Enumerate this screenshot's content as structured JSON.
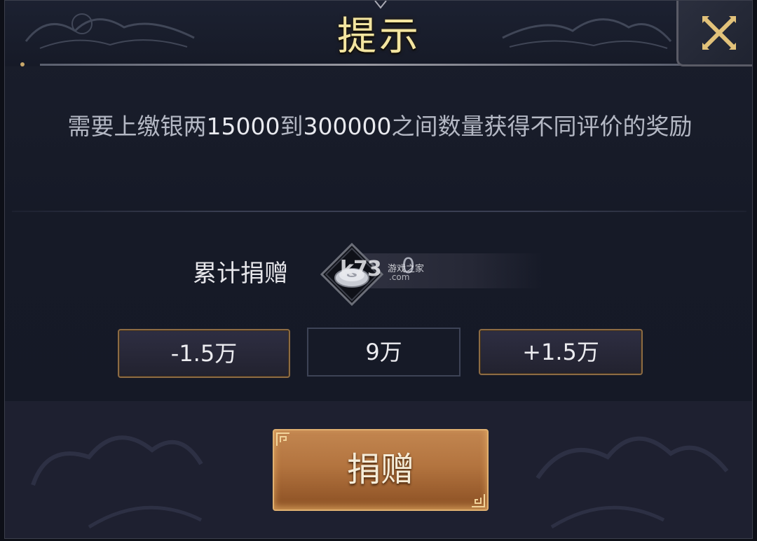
{
  "dialog": {
    "title": "提示",
    "close_icon": "close-icon",
    "message": {
      "part1": "需要上缴银两",
      "min": "15000",
      "part2": "到",
      "max": "300000",
      "part3": "之间数量获得不同评价的奖励"
    }
  },
  "donation": {
    "label": "累计捐赠",
    "currency_icon": "silver-coin-icon",
    "accumulated_value": "0",
    "decrease_label": "-1.5万",
    "current_amount": "9万",
    "increase_label": "+1.5万",
    "submit_label": "捐赠"
  },
  "watermark": {
    "brand": "k73",
    "cn": "游戏之家",
    "domain": ".com"
  },
  "colors": {
    "title": "#f3e5a0",
    "button_border": "#8c6b44",
    "donate_button": "#b3743f",
    "background": "#161a27"
  }
}
